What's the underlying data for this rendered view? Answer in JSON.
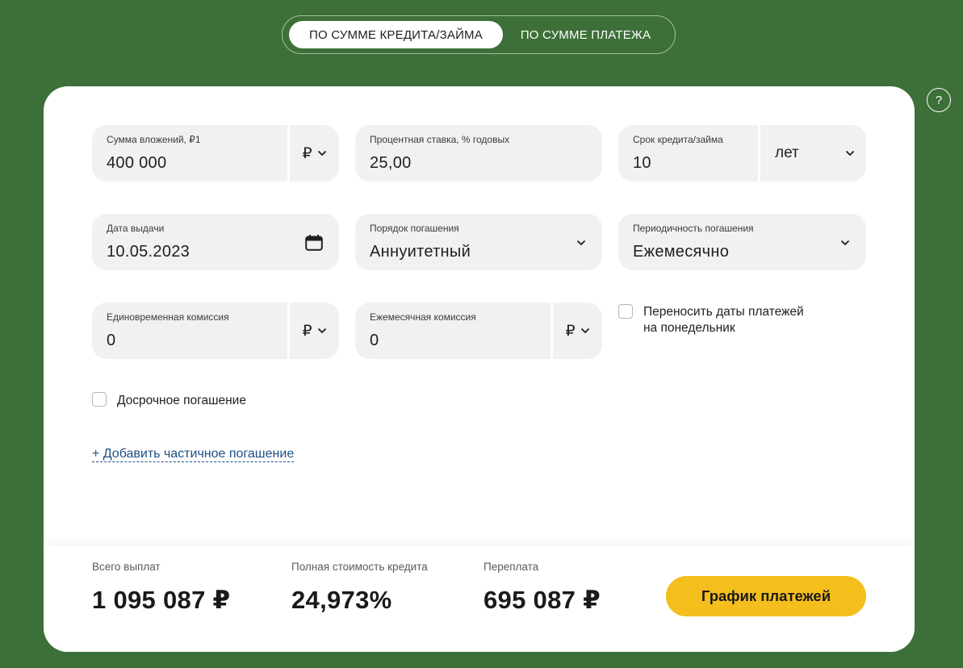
{
  "mode_tabs": [
    {
      "label": "ПО СУММЕ КРЕДИТА/ЗАЙМА",
      "active": true
    },
    {
      "label": "ПО СУММЕ ПЛАТЕЖА",
      "active": false
    }
  ],
  "help": {
    "label": "?"
  },
  "fields": {
    "amount": {
      "label": "Сумма вложений, ₽1",
      "value": "400 000",
      "currency": "₽"
    },
    "rate": {
      "label": "Процентная ставка, % годовых",
      "value": "25,00"
    },
    "term": {
      "label": "Срок кредита/займа",
      "value": "10",
      "unit": "лет"
    },
    "issue_date": {
      "label": "Дата выдачи",
      "value": "10.05.2023"
    },
    "repayment_order": {
      "label": "Порядок погашения",
      "value": "Аннуитетный"
    },
    "repayment_frequency": {
      "label": "Периодичность погашения",
      "value": "Ежемесячно"
    },
    "one_time_fee": {
      "label": "Единовременная комиссия",
      "value": "0",
      "currency": "₽"
    },
    "monthly_fee": {
      "label": "Ежемесячная комиссия",
      "value": "0",
      "currency": "₽"
    }
  },
  "checkboxes": {
    "move_to_monday": {
      "line1": "Переносить даты платежей",
      "line2": "на понедельник",
      "checked": false
    },
    "early_repayment": {
      "label": "Досрочное погашение",
      "checked": false
    }
  },
  "add_partial_link": "+ Добавить частичное погашение",
  "summary": {
    "total": {
      "label": "Всего выплат",
      "value": "1 095 087 ₽"
    },
    "full_cost": {
      "label": "Полная стоимость кредита",
      "value": "24,973%"
    },
    "overpayment": {
      "label": "Переплата",
      "value": "695 087 ₽"
    },
    "schedule_button": "График платежей"
  },
  "colors": {
    "background": "#3c7038",
    "accent": "#f4be1c",
    "field": "#f1f1f1",
    "link": "#1e4e86"
  },
  "icons": [
    "chevron-down-icon",
    "calendar-icon",
    "help-icon"
  ]
}
